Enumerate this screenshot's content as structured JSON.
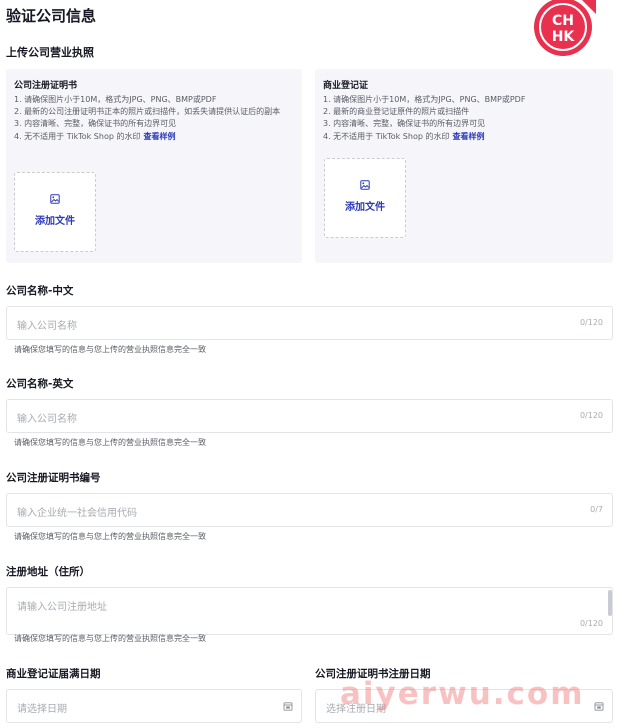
{
  "page": {
    "title": "验证公司信息",
    "section_title": "上传公司营业执照"
  },
  "logo": {
    "line1": "CH",
    "line2": "HK",
    "color": "#e8304f"
  },
  "cards": [
    {
      "title": "公司注册证明书",
      "requirements": [
        "1. 请确保图片小于10M，格式为JPG、PNG、BMP或PDF",
        "2. 最新的公司注册证明书正本的照片或扫描件，如丢失请提供认证后的副本",
        "3. 内容清晰、完整，确保证书的所有边界可见",
        "4. 无不适用于 TikTok Shop 的水印"
      ],
      "sample_link": "查看样例",
      "upload_label": "添加文件"
    },
    {
      "title": "商业登记证",
      "requirements": [
        "1. 请确保图片小于10M，格式为JPG、PNG、BMP或PDF",
        "2. 最新的商业登记证原件的照片或扫描件",
        "3. 内容清晰、完整，确保证书的所有边界可见",
        "4. 无不适用于 TikTok Shop 的水印"
      ],
      "sample_link": "查看样例",
      "upload_label": "添加文件"
    }
  ],
  "fields": {
    "name_cn": {
      "label": "公司名称-中文",
      "placeholder": "输入公司名称",
      "count": "0/120",
      "hint": "请确保您填写的信息与您上传的营业执照信息完全一致"
    },
    "name_en": {
      "label": "公司名称-英文",
      "placeholder": "输入公司名称",
      "count": "0/120",
      "hint": "请确保您填写的信息与您上传的营业执照信息完全一致"
    },
    "reg_no": {
      "label": "公司注册证明书编号",
      "placeholder": "输入企业统一社会信用代码",
      "count": "0/7",
      "hint": "请确保您填写的信息与您上传的营业执照信息完全一致"
    },
    "address": {
      "label": "注册地址（住所）",
      "placeholder": "请输入公司注册地址",
      "count": "0/120",
      "hint": "请确保您填写的信息与您上传的营业执照信息完全一致"
    },
    "br_expiry": {
      "label": "商业登记证届满日期",
      "placeholder": "请选择日期"
    },
    "reg_date": {
      "label": "公司注册证明书注册日期",
      "placeholder": "选择注册日期"
    }
  },
  "watermark": "aiyerwu.com"
}
